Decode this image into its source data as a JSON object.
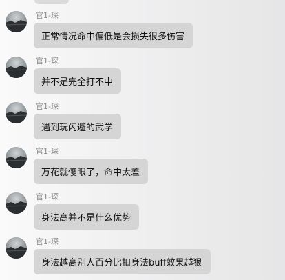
{
  "chat": {
    "messages": [
      {
        "sender": "官1-琛",
        "text": "正常情况命中偏低是会损失很多伤害"
      },
      {
        "sender": "官1-琛",
        "text": "并不是完全打不中"
      },
      {
        "sender": "官1-琛",
        "text": "遇到玩闪避的武学"
      },
      {
        "sender": "官1-琛",
        "text": "万花就傻眼了，命中太差"
      },
      {
        "sender": "官1-琛",
        "text": "身法高并不是什么优势"
      },
      {
        "sender": "官1-琛",
        "text": "身法越高别人百分比扣身法buff效果越狠"
      }
    ]
  }
}
